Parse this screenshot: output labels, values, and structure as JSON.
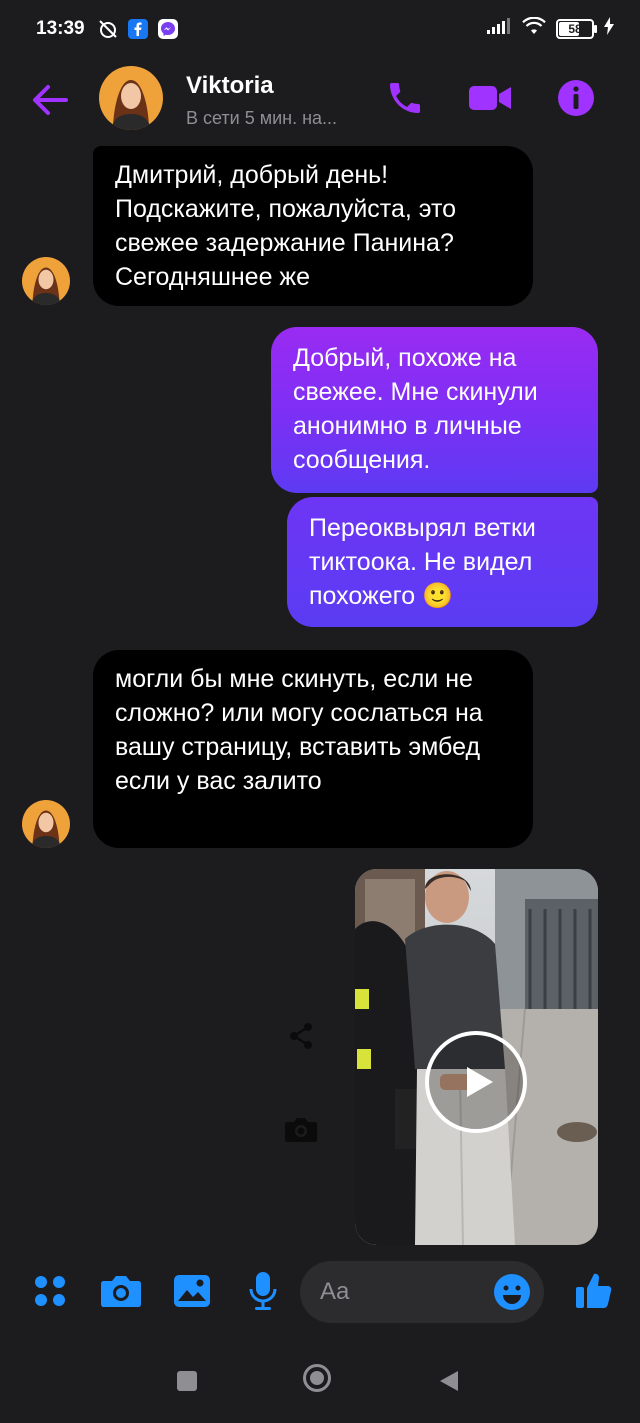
{
  "status_bar": {
    "time": "13:39",
    "battery": "58"
  },
  "header": {
    "contact_name": "Viktoria",
    "presence": "В сети 5 мин. на..."
  },
  "messages": [
    {
      "direction": "incoming",
      "text": "Дмитрий, добрый день! Подскажите, пожалуйста, это свежее задержание Панина? Сегодняшнее же"
    },
    {
      "direction": "outgoing",
      "text": "Добрый, похоже на свежее. Мне скинули анонимно в личные сообщения."
    },
    {
      "direction": "outgoing",
      "text": "Переоквырял ветки тиктоока. Не видел похожего 🙂"
    },
    {
      "direction": "incoming",
      "text": "могли бы мне скинуть, если не сложно? или могу сослаться на вашу страницу, вставить эмбед если у вас залито"
    }
  ],
  "composer": {
    "placeholder": "Aa"
  },
  "colors": {
    "accent_purple": "#a033ff",
    "messenger_blue": "#1e90ff",
    "bubble_in": "#000000",
    "background": "#1c1c1e"
  },
  "icons": [
    "back-arrow-icon",
    "phone-icon",
    "video-camera-icon",
    "info-icon",
    "share-icon",
    "camera-icon",
    "apps-grid-icon",
    "image-icon",
    "microphone-icon",
    "emoji-icon",
    "thumbs-up-icon"
  ]
}
